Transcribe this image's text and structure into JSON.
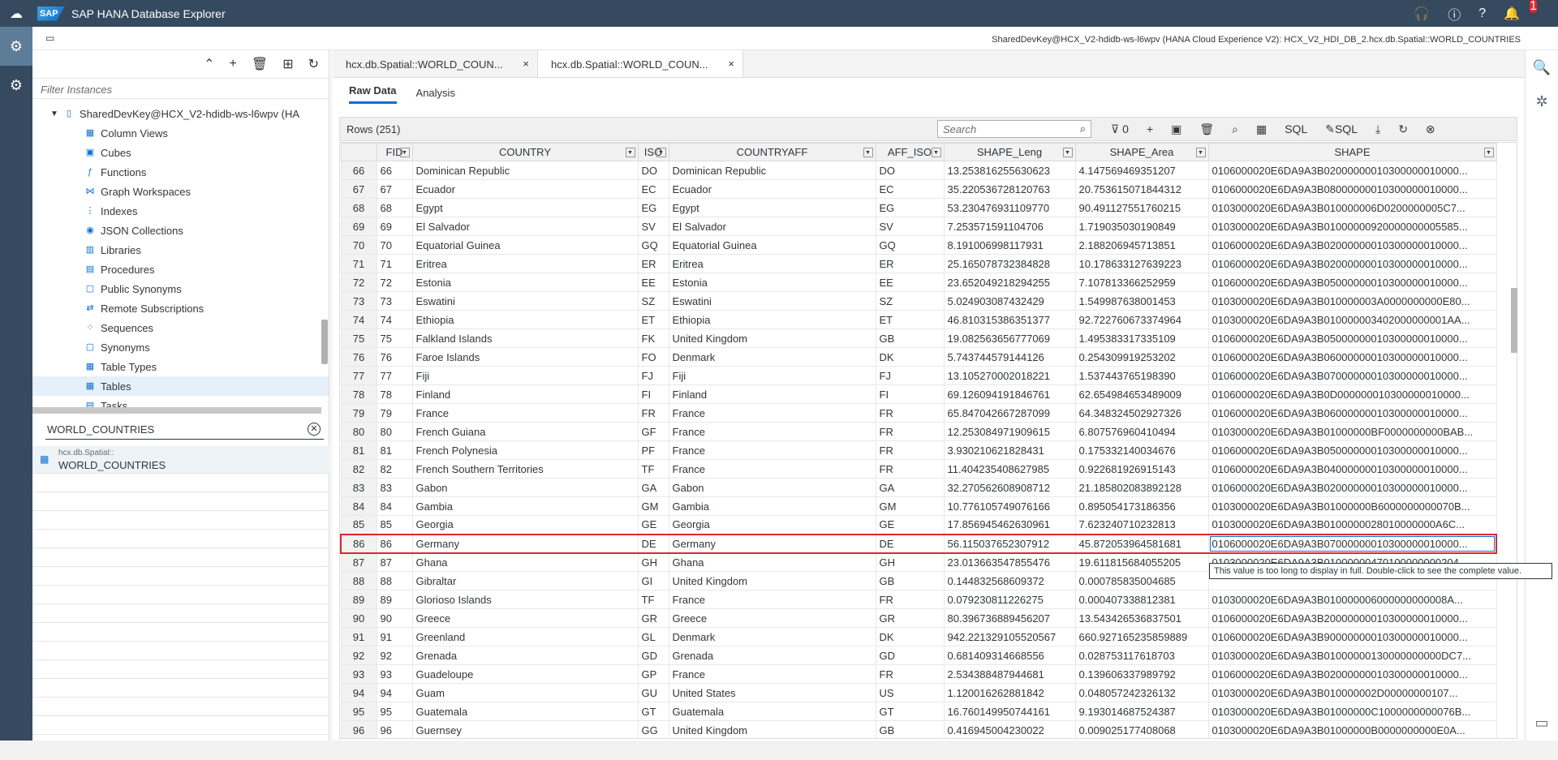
{
  "shell": {
    "title": "SAP HANA Database Explorer",
    "logo": "SAP",
    "notification_count": "1"
  },
  "topbar": {
    "connection": "SharedDevKey@HCX_V2-hdidb-ws-l6wpv (HANA Cloud Experience V2): HCX_V2_HDI_DB_2.hcx.db.Spatial::WORLD_COUNTRIES"
  },
  "left": {
    "filter_placeholder": "Filter Instances",
    "root": "SharedDevKey@HCX_V2-hdidb-ws-l6wpv (HA",
    "items": [
      "Column Views",
      "Cubes",
      "Functions",
      "Graph Workspaces",
      "Indexes",
      "JSON Collections",
      "Libraries",
      "Procedures",
      "Public Synonyms",
      "Remote Subscriptions",
      "Sequences",
      "Synonyms",
      "Table Types",
      "Tables",
      "Tasks"
    ],
    "search_value": "WORLD_COUNTRIES",
    "result_schema": "hcx.db.Spatial::",
    "result_name": "WORLD_COUNTRIES"
  },
  "tabs": [
    {
      "label": "hcx.db.Spatial::WORLD_COUN..."
    },
    {
      "label": "hcx.db.Spatial::WORLD_COUN..."
    }
  ],
  "subtabs": {
    "raw": "Raw Data",
    "analysis": "Analysis"
  },
  "grid": {
    "rows_label": "Rows (251)",
    "search_placeholder": "Search",
    "filter_count": "0",
    "sql1": "SQL",
    "sql2": "SQL",
    "columns": [
      "FID",
      "COUNTRY",
      "ISO",
      "COUNTRYAFF",
      "AFF_ISO",
      "SHAPE_Leng",
      "SHAPE_Area",
      "SHAPE"
    ],
    "rows": [
      [
        "66",
        "66",
        "Dominican Republic",
        "DO",
        "Dominican Republic",
        "DO",
        "13.253816255630623",
        "4.147569469351207",
        "0106000020E6DA9A3B02000000010300000010000..."
      ],
      [
        "67",
        "67",
        "Ecuador",
        "EC",
        "Ecuador",
        "EC",
        "35.220536728120763",
        "20.753615071844312",
        "0106000020E6DA9A3B08000000010300000010000..."
      ],
      [
        "68",
        "68",
        "Egypt",
        "EG",
        "Egypt",
        "EG",
        "53.230476931109770",
        "90.491127551760215",
        "0103000020E6DA9A3B010000006D0200000005C7..."
      ],
      [
        "69",
        "69",
        "El Salvador",
        "SV",
        "El Salvador",
        "SV",
        "7.253571591104706",
        "1.719035030190849",
        "0103000020E6DA9A3B01000000920000000005585..."
      ],
      [
        "70",
        "70",
        "Equatorial Guinea",
        "GQ",
        "Equatorial Guinea",
        "GQ",
        "8.191006998117931",
        "2.188206945713851",
        "0106000020E6DA9A3B02000000010300000010000..."
      ],
      [
        "71",
        "71",
        "Eritrea",
        "ER",
        "Eritrea",
        "ER",
        "25.165078732384828",
        "10.178633127639223",
        "0106000020E6DA9A3B02000000010300000010000..."
      ],
      [
        "72",
        "72",
        "Estonia",
        "EE",
        "Estonia",
        "EE",
        "23.652049218294255",
        "7.107813366252959",
        "0106000020E6DA9A3B05000000010300000010000..."
      ],
      [
        "73",
        "73",
        "Eswatini",
        "SZ",
        "Eswatini",
        "SZ",
        "5.024903087432429",
        "1.549987638001453",
        "0103000020E6DA9A3B010000003A0000000000E80..."
      ],
      [
        "74",
        "74",
        "Ethiopia",
        "ET",
        "Ethiopia",
        "ET",
        "46.810315386351377",
        "92.722760673374964",
        "0103000020E6DA9A3B010000003402000000001AA..."
      ],
      [
        "75",
        "75",
        "Falkland Islands",
        "FK",
        "United Kingdom",
        "GB",
        "19.082563656777069",
        "1.495383317335109",
        "0106000020E6DA9A3B05000000010300000010000..."
      ],
      [
        "76",
        "76",
        "Faroe Islands",
        "FO",
        "Denmark",
        "DK",
        "5.743744579144126",
        "0.254309919253202",
        "0106000020E6DA9A3B06000000010300000010000..."
      ],
      [
        "77",
        "77",
        "Fiji",
        "FJ",
        "Fiji",
        "FJ",
        "13.105270002018221",
        "1.537443765198390",
        "0106000020E6DA9A3B07000000010300000010000..."
      ],
      [
        "78",
        "78",
        "Finland",
        "FI",
        "Finland",
        "FI",
        "69.126094191846761",
        "62.654984653489009",
        "0106000020E6DA9A3B0D000000010300000010000..."
      ],
      [
        "79",
        "79",
        "France",
        "FR",
        "France",
        "FR",
        "65.847042667287099",
        "64.348324502927326",
        "0106000020E6DA9A3B06000000010300000010000..."
      ],
      [
        "80",
        "80",
        "French Guiana",
        "GF",
        "France",
        "FR",
        "12.253084971909615",
        "6.807576960410494",
        "0103000020E6DA9A3B01000000BF0000000000BAB..."
      ],
      [
        "81",
        "81",
        "French Polynesia",
        "PF",
        "France",
        "FR",
        "3.930210621828431",
        "0.175332140034676",
        "0106000020E6DA9A3B05000000010300000010000..."
      ],
      [
        "82",
        "82",
        "French Southern Territories",
        "TF",
        "France",
        "FR",
        "11.404235408627985",
        "0.922681926915143",
        "0106000020E6DA9A3B04000000010300000010000..."
      ],
      [
        "83",
        "83",
        "Gabon",
        "GA",
        "Gabon",
        "GA",
        "32.270562608908712",
        "21.185802083892128",
        "0106000020E6DA9A3B02000000010300000010000..."
      ],
      [
        "84",
        "84",
        "Gambia",
        "GM",
        "Gambia",
        "GM",
        "10.776105749076166",
        "0.895054173186356",
        "0103000020E6DA9A3B01000000B6000000000070B..."
      ],
      [
        "85",
        "85",
        "Georgia",
        "GE",
        "Georgia",
        "GE",
        "17.856945462630961",
        "7.623240710232813",
        "0103000020E6DA9A3B0100000028010000000A6C..."
      ],
      [
        "86",
        "86",
        "Germany",
        "DE",
        "Germany",
        "DE",
        "56.115037652307912",
        "45.872053964581681",
        "0106000020E6DA9A3B07000000010300000010000..."
      ],
      [
        "87",
        "87",
        "Ghana",
        "GH",
        "Ghana",
        "GH",
        "23.013663547855476",
        "19.611815684055205",
        "0103000020E6DA9A3B01000000470100000000204..."
      ],
      [
        "88",
        "88",
        "Gibraltar",
        "GI",
        "United Kingdom",
        "GB",
        "0.144832568609372",
        "0.000785835004685",
        ""
      ],
      [
        "89",
        "89",
        "Glorioso Islands",
        "TF",
        "France",
        "FR",
        "0.079230811226275",
        "0.000407338812381",
        "0103000020E6DA9A3B010000006000000000008A..."
      ],
      [
        "90",
        "90",
        "Greece",
        "GR",
        "Greece",
        "GR",
        "80.396736889456207",
        "13.543426536837501",
        "0106000020E6DA9A3B20000000010300000010000..."
      ],
      [
        "91",
        "91",
        "Greenland",
        "GL",
        "Denmark",
        "DK",
        "942.221329105520567",
        "660.927165235859889",
        "0106000020E6DA9A3B90000000010300000010000..."
      ],
      [
        "92",
        "92",
        "Grenada",
        "GD",
        "Grenada",
        "GD",
        "0.681409314668556",
        "0.028753117618703",
        "0103000020E6DA9A3B01000000130000000000DC7..."
      ],
      [
        "93",
        "93",
        "Guadeloupe",
        "GP",
        "France",
        "FR",
        "2.534388487944681",
        "0.139606337989792",
        "0106000020E6DA9A3B02000000010300000010000..."
      ],
      [
        "94",
        "94",
        "Guam",
        "GU",
        "United States",
        "US",
        "1.120016262881842",
        "0.048057242326132",
        "0103000020E6DA9A3B010000002D00000000107..."
      ],
      [
        "95",
        "95",
        "Guatemala",
        "GT",
        "Guatemala",
        "GT",
        "16.760149950744161",
        "9.193014687524387",
        "0103000020E6DA9A3B01000000C1000000000076B..."
      ],
      [
        "96",
        "96",
        "Guernsey",
        "GG",
        "United Kingdom",
        "GB",
        "0.416945004230022",
        "0.009025177408068",
        "0103000020E6DA9A3B01000000B0000000000E0A..."
      ]
    ]
  },
  "tooltip": "This value is too long to display in full. Double-click to see the complete value."
}
